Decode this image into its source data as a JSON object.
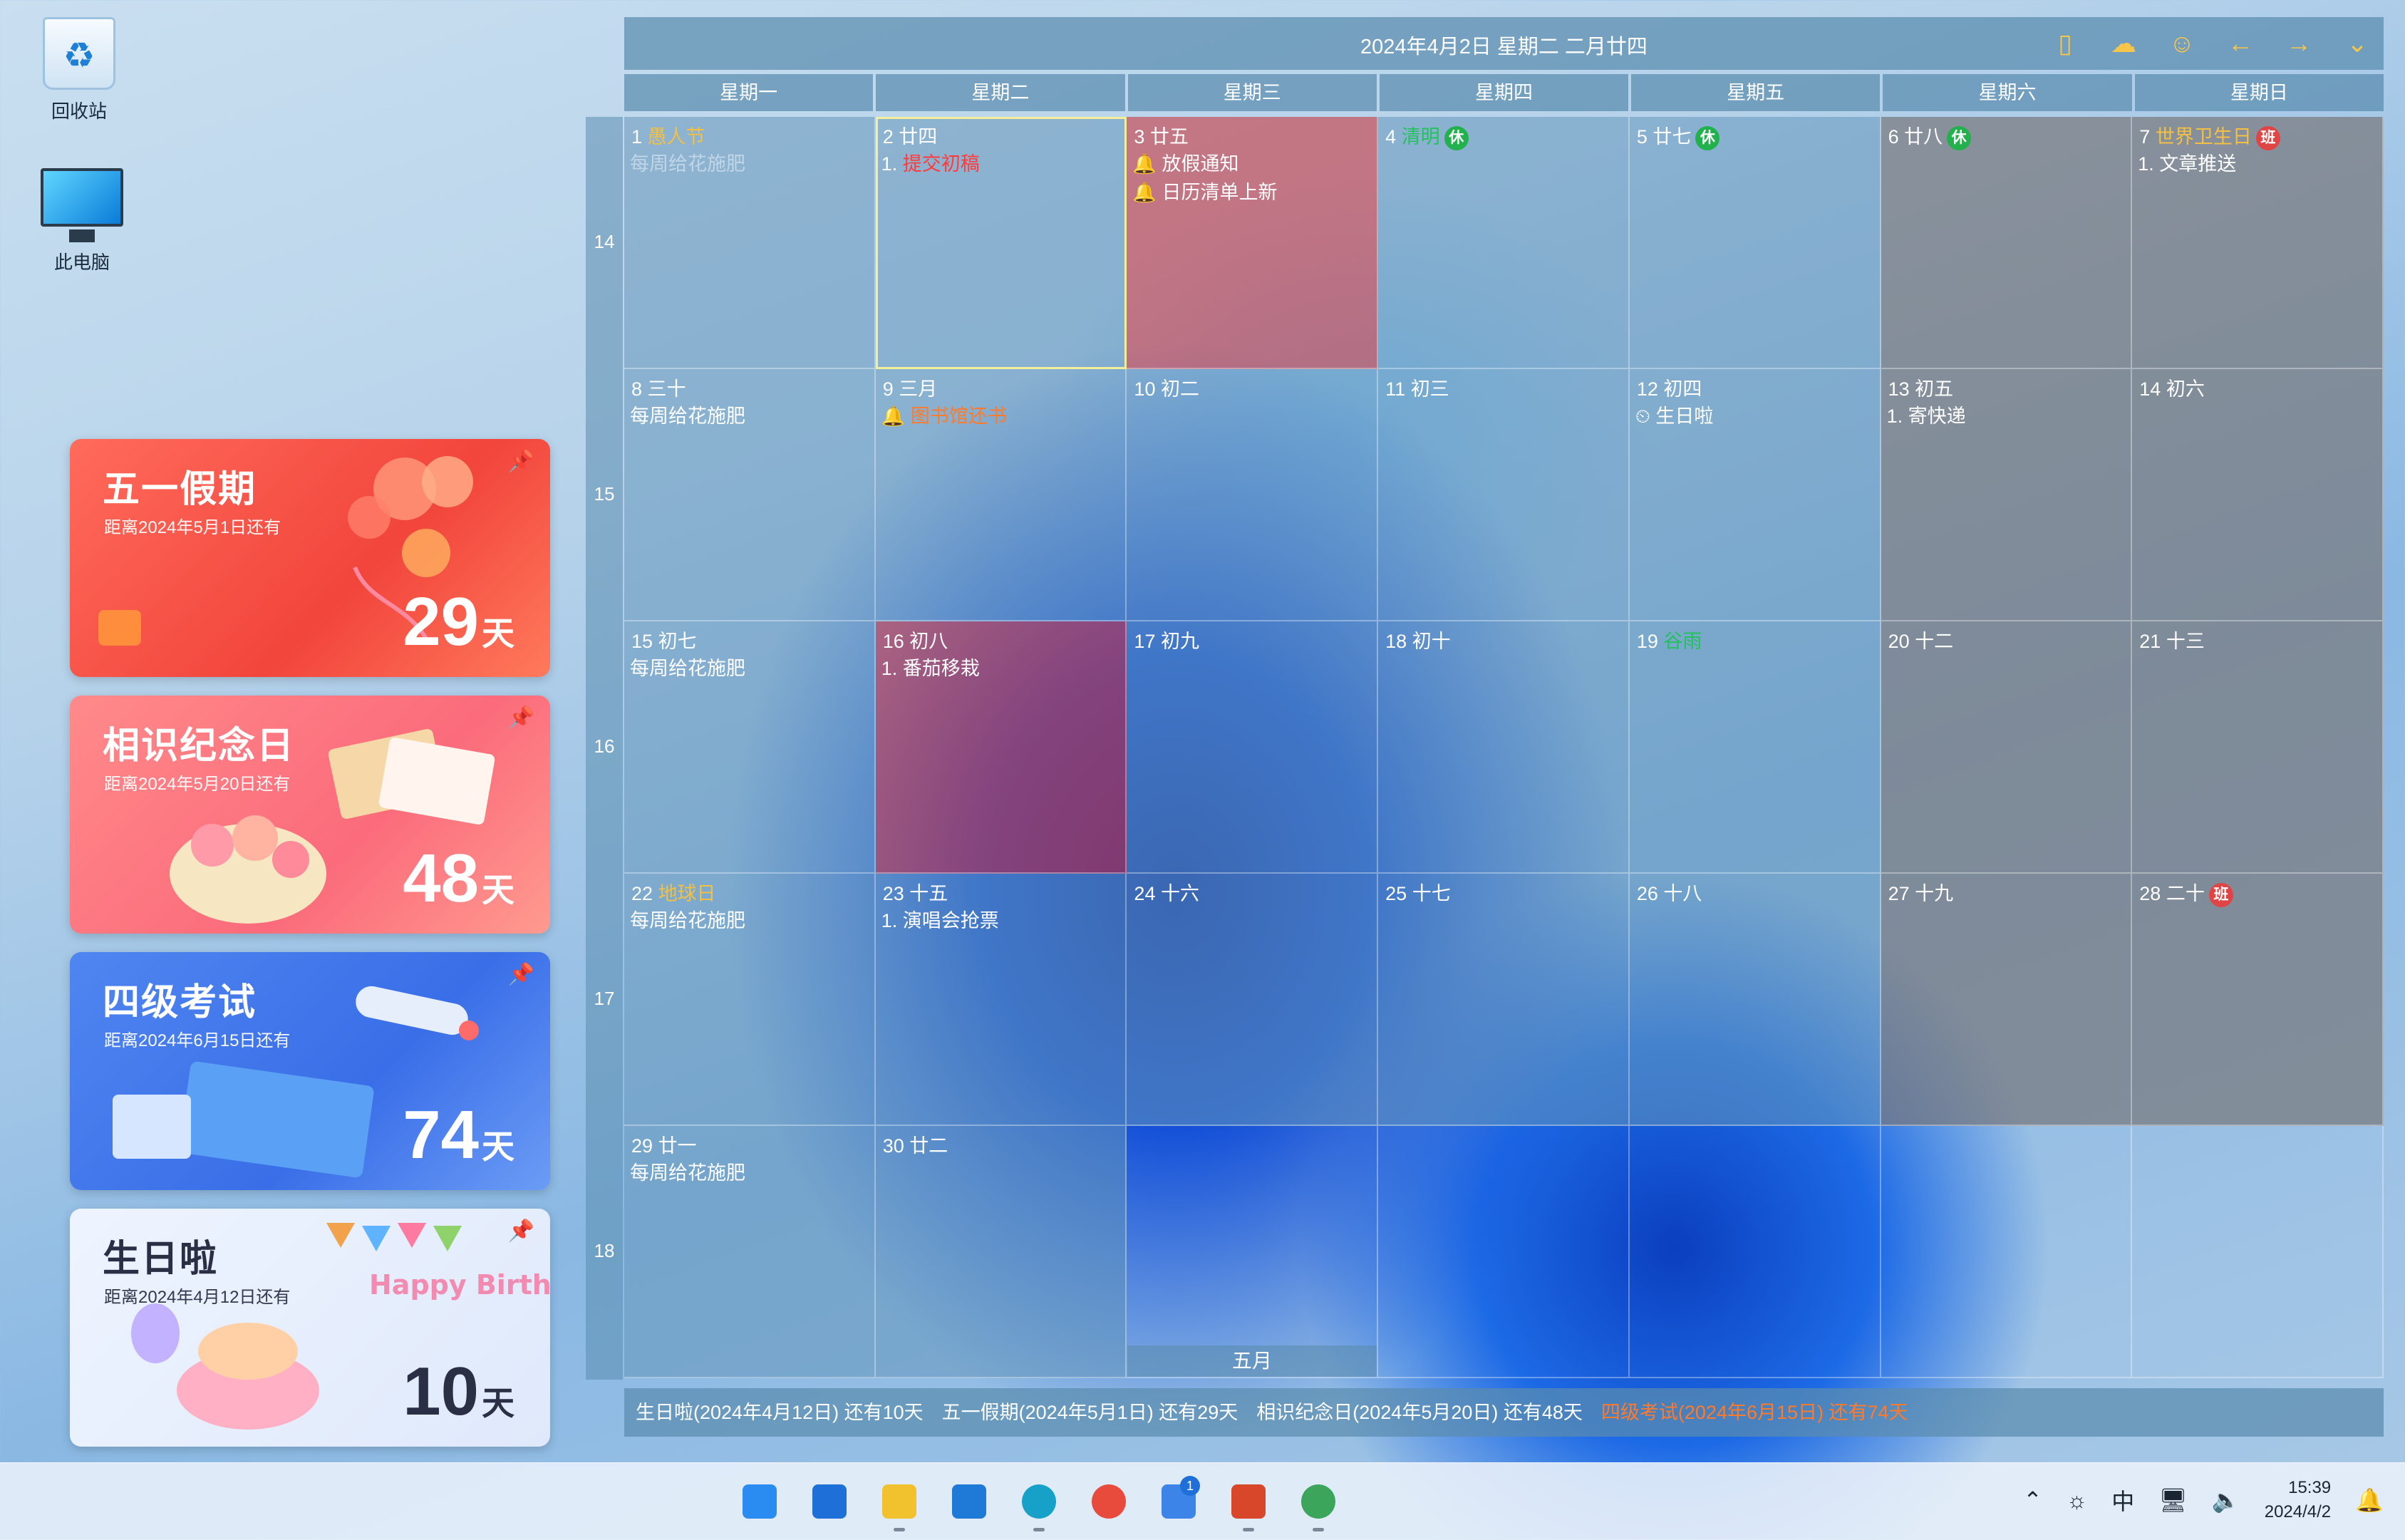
{
  "desktop": {
    "icons": [
      {
        "label": "回收站",
        "icon": "recycle-bin-icon"
      },
      {
        "label": "此电脑",
        "icon": "computer-icon"
      }
    ]
  },
  "cards": [
    {
      "title": "五一假期",
      "sub": "距离2024年5月1日还有",
      "num": "29",
      "unit": "天",
      "color": "#f2453c"
    },
    {
      "title": "相识纪念日",
      "sub": "距离2024年5月20日还有",
      "num": "48",
      "unit": "天",
      "color": "#fb6b7b"
    },
    {
      "title": "四级考试",
      "sub": "距离2024年6月15日还有",
      "num": "74",
      "unit": "天",
      "color": "#3a6ee8"
    },
    {
      "title": "生日啦",
      "sub": "距离2024年4月12日还有",
      "num": "10",
      "unit": "天",
      "color": "#dfe9fb",
      "art_text": "Happy BirthDay"
    }
  ],
  "calendar": {
    "header_date": "2024年4月2日 星期二 二月廿四",
    "weekdays": [
      "星期一",
      "星期二",
      "星期三",
      "星期四",
      "星期五",
      "星期六",
      "星期日"
    ],
    "week_numbers": [
      "14",
      "15",
      "16",
      "17",
      "18"
    ],
    "month_label": "五月",
    "badge_rest": "休",
    "badge_work": "班",
    "cells": [
      {
        "d": "1",
        "l": "愚人节",
        "lc": "hol",
        "ev": [
          {
            "t": "每周给花施肥",
            "s": "faded"
          }
        ]
      },
      {
        "d": "2",
        "l": "廿四",
        "today": true,
        "ev": [
          {
            "t": "1. ",
            "s": "",
            "t2": "提交初稿",
            "s2": "redtxt"
          }
        ]
      },
      {
        "d": "3",
        "l": "廿五",
        "red": true,
        "ev": [
          {
            "t": "🔔 放假通知"
          },
          {
            "t": "🔔 日历清单上新"
          }
        ]
      },
      {
        "d": "4",
        "l": "清明",
        "lc": "grn",
        "badge": "rest"
      },
      {
        "d": "5",
        "l": "廿七",
        "badge": "rest"
      },
      {
        "d": "6",
        "l": "廿八",
        "badge": "rest",
        "weekend": true
      },
      {
        "d": "7",
        "l": "世界卫生日",
        "lc": "hol",
        "badge": "work",
        "weekend": true,
        "ev": [
          {
            "t": "1. 文章推送"
          }
        ]
      },
      {
        "d": "8",
        "l": "三十",
        "ev": [
          {
            "t": "每周给花施肥"
          }
        ]
      },
      {
        "d": "9",
        "l": "三月",
        "ev": [
          {
            "t": "🔔 图书馆还书",
            "s": "orange"
          }
        ]
      },
      {
        "d": "10",
        "l": "初二"
      },
      {
        "d": "11",
        "l": "初三"
      },
      {
        "d": "12",
        "l": "初四",
        "ev": [
          {
            "t": "⏲ 生日啦"
          }
        ]
      },
      {
        "d": "13",
        "l": "初五",
        "weekend": true,
        "ev": [
          {
            "t": "1. 寄快递"
          }
        ]
      },
      {
        "d": "14",
        "l": "初六",
        "weekend": true
      },
      {
        "d": "15",
        "l": "初七",
        "ev": [
          {
            "t": "每周给花施肥"
          }
        ]
      },
      {
        "d": "16",
        "l": "初八",
        "red": true,
        "ev": [
          {
            "t": "1. 番茄移栽"
          }
        ]
      },
      {
        "d": "17",
        "l": "初九"
      },
      {
        "d": "18",
        "l": "初十"
      },
      {
        "d": "19",
        "l": "谷雨",
        "lc": "grn"
      },
      {
        "d": "20",
        "l": "十二",
        "weekend": true
      },
      {
        "d": "21",
        "l": "十三",
        "weekend": true
      },
      {
        "d": "22",
        "l": "地球日",
        "lc": "hol",
        "ev": [
          {
            "t": "每周给花施肥"
          }
        ]
      },
      {
        "d": "23",
        "l": "十五",
        "ev": [
          {
            "t": "1. 演唱会抢票"
          }
        ]
      },
      {
        "d": "24",
        "l": "十六"
      },
      {
        "d": "25",
        "l": "十七"
      },
      {
        "d": "26",
        "l": "十八"
      },
      {
        "d": "27",
        "l": "十九",
        "weekend": true
      },
      {
        "d": "28",
        "l": "二十",
        "badge": "work",
        "weekend": true
      },
      {
        "d": "29",
        "l": "廿一",
        "ev": [
          {
            "t": "每周给花施肥"
          }
        ]
      },
      {
        "d": "30",
        "l": "廿二"
      }
    ],
    "footer": [
      {
        "t": "生日啦(2024年4月12日) 还有10天"
      },
      {
        "t": "五一假期(2024年5月1日) 还有29天"
      },
      {
        "t": "相识纪念日(2024年5月20日) 还有48天"
      },
      {
        "t": "四级考试(2024年6月15日) 还有74天",
        "warn": true
      }
    ]
  },
  "taskbar": {
    "apps": [
      {
        "name": "start-icon",
        "color": "#2a8cf0"
      },
      {
        "name": "search-icon",
        "color": "#1f6fd8"
      },
      {
        "name": "file-explorer-icon",
        "color": "#f2c12e",
        "running": true
      },
      {
        "name": "vscode-icon",
        "color": "#1e7ad6"
      },
      {
        "name": "edge-icon",
        "color": "#17a1c9",
        "running": true
      },
      {
        "name": "chrome-icon",
        "color": "#e84b3c"
      },
      {
        "name": "todo-icon",
        "color": "#3d84e8",
        "count": "1"
      },
      {
        "name": "powerpoint-icon",
        "color": "#d9472b",
        "running": true
      },
      {
        "name": "chrome-profile-icon",
        "color": "#3ba55c",
        "running": true
      }
    ],
    "tray": {
      "ime": "中",
      "time": "15:39",
      "date": "2024/4/2"
    }
  },
  "colors": {
    "accent_gold": "#f5c64a",
    "holiday": "#f3c043",
    "solar_term": "#22c25a",
    "warning": "#ff7a2a"
  }
}
